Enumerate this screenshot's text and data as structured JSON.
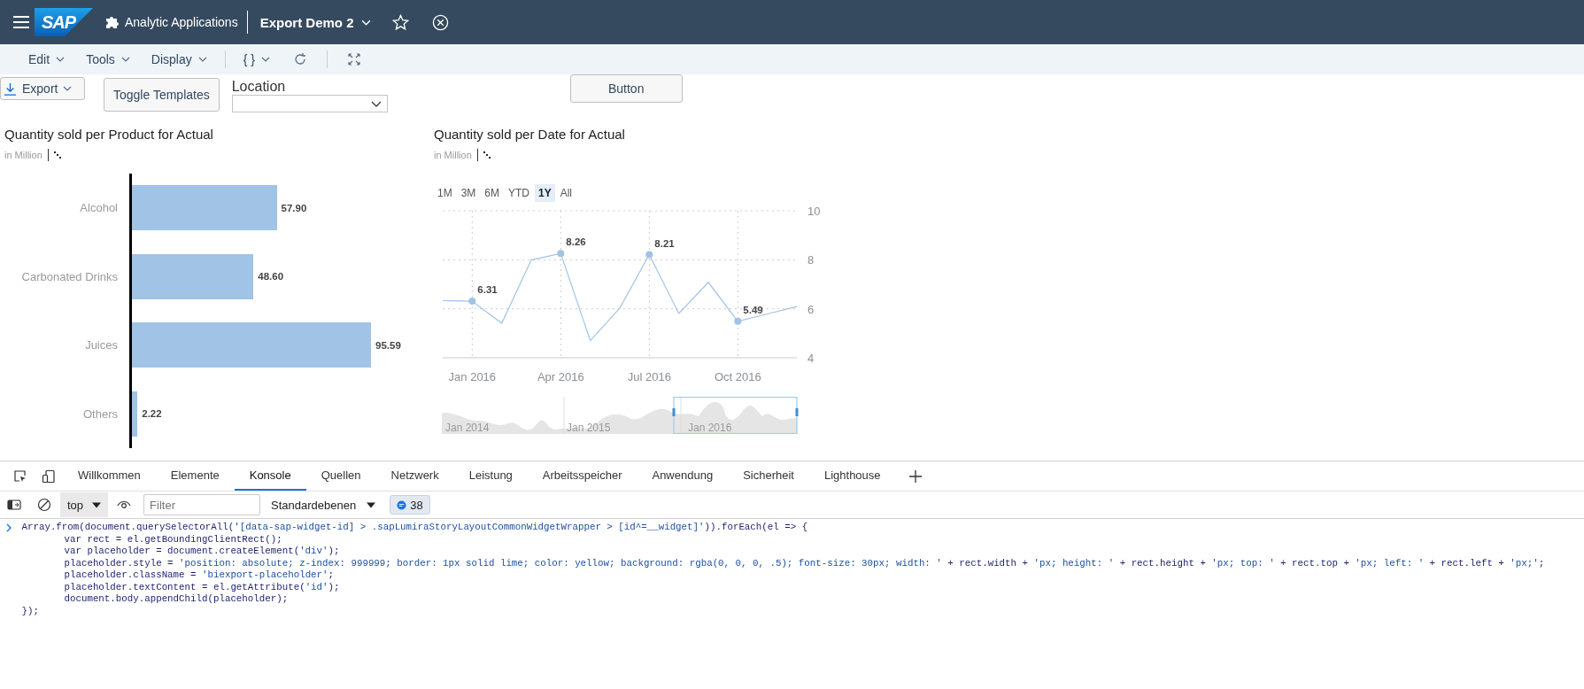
{
  "header": {
    "logo": "SAP",
    "app_name": "Analytic Applications",
    "document_title": "Export Demo 2"
  },
  "toolbar": {
    "menus": [
      "Edit",
      "Tools",
      "Display"
    ],
    "code_menu": "{ }"
  },
  "controls": {
    "export": "Export",
    "toggle": "Toggle Templates",
    "location": {
      "label": "Location"
    },
    "button": "Button"
  },
  "bar_chart": {
    "title": "Quantity sold per Product for Actual",
    "unit": "in Million",
    "chart_data": {
      "type": "bar",
      "orientation": "horizontal",
      "categories": [
        "Alcohol",
        "Carbonated Drinks",
        "Juices",
        "Others"
      ],
      "values": [
        57.9,
        48.6,
        95.59,
        2.22
      ],
      "value_labels": [
        "57.90",
        "48.60",
        "95.59",
        "2.22"
      ]
    }
  },
  "line_chart": {
    "title": "Quantity sold per Date for Actual",
    "unit": "in Million",
    "ranges": [
      {
        "label": "1M",
        "selected": false
      },
      {
        "label": "3M",
        "selected": false
      },
      {
        "label": "6M",
        "selected": false
      },
      {
        "label": "YTD",
        "selected": false
      },
      {
        "label": "1Y",
        "selected": true
      },
      {
        "label": "All",
        "selected": false
      }
    ],
    "chart_data": {
      "type": "line",
      "categories": [
        null,
        "Jan 2016",
        null,
        null,
        "Apr 2016",
        null,
        null,
        "Jul 2016",
        null,
        null,
        "Oct 2016",
        null,
        null
      ],
      "values": [
        6.33,
        6.31,
        5.41,
        7.99,
        8.26,
        4.7,
        6.03,
        8.21,
        5.81,
        7.08,
        5.49,
        5.79,
        6.09
      ],
      "grid": true,
      "ylim": [
        4,
        10
      ],
      "yticks": [
        4,
        6,
        8,
        10
      ],
      "value_labels": [
        null,
        "6.31",
        null,
        null,
        "8.26",
        null,
        null,
        "8.21",
        null,
        null,
        "5.49",
        null,
        null
      ]
    },
    "navigator": {
      "labels": [
        "Jan 2014",
        "Jan 2015",
        "Jan 2016"
      ]
    }
  },
  "devtools": {
    "tabs": [
      {
        "label": "Willkommen",
        "selected": false
      },
      {
        "label": "Elemente",
        "selected": false
      },
      {
        "label": "Konsole",
        "selected": true
      },
      {
        "label": "Quellen",
        "selected": false
      },
      {
        "label": "Netzwerk",
        "selected": false
      },
      {
        "label": "Leistung",
        "selected": false
      },
      {
        "label": "Arbeitsspeicher",
        "selected": false
      },
      {
        "label": "Anwendung",
        "selected": false
      },
      {
        "label": "Sicherheit",
        "selected": false
      },
      {
        "label": "Lighthouse",
        "selected": false
      }
    ],
    "context": "top",
    "filter": {
      "placeholder": "Filter"
    },
    "levels": "Standardebenen",
    "message_count": "38",
    "console": [
      {
        "text": "Array.from(document.querySelectorAll('[data-sap-widget-id] > .sapLumiraStoryLayoutCommonWidgetWrapper > [id^=__widget]')).forEach(el => {",
        "children": [
          {
            "text": "var rect = el.getBoundingClientRect();"
          },
          {
            "text": "var placeholder = document.createElement('div');"
          },
          {
            "text": "placeholder.style = 'position: absolute; z-index: 999999; border: 1px solid lime; color: yellow; background: rgba(0, 0, 0, .5); font-size: 30px; width: ' + rect.width + 'px; height: ' + rect.height + 'px; top: ' + rect.top + 'px; left: ' + rect.left + 'px;';"
          },
          {
            "text": "placeholder.className = 'biexport-placeholder';"
          },
          {
            "text": "placeholder.textContent = el.getAttribute('id');"
          },
          {
            "text": "document.body.appendChild(placeholder);"
          }
        ]
      },
      {
        "text": "});"
      }
    ]
  }
}
